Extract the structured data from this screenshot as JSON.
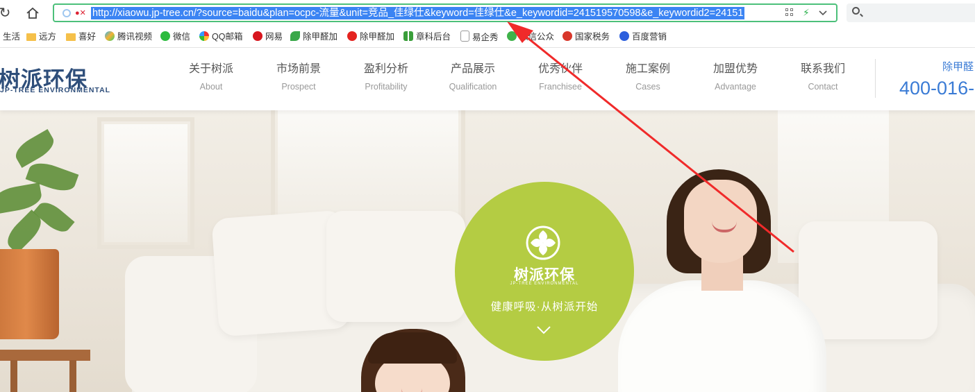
{
  "browser": {
    "url": "http://xiaowu.jp-tree.cn/?source=baidu&plan=ocpc-流量&unit=竞品_佳绿仕&keyword=佳绿仕&e_keywordid=241519570598&e_keywordid2=24151",
    "bookmarks": [
      {
        "label": "生活",
        "icon": "generic-icon"
      },
      {
        "label": "远方",
        "icon": "folder-icon"
      },
      {
        "label": "喜好",
        "icon": "folder-icon"
      },
      {
        "label": "腾讯视频",
        "icon": "tencent-video-icon"
      },
      {
        "label": "微信",
        "icon": "wechat-icon"
      },
      {
        "label": "QQ邮箱",
        "icon": "qq-mail-icon"
      },
      {
        "label": "网易",
        "icon": "netease-icon"
      },
      {
        "label": "除甲醛加",
        "icon": "leaf-icon"
      },
      {
        "label": "除甲醛加",
        "icon": "c-logo-icon"
      },
      {
        "label": "章科后台",
        "icon": "grid-icon"
      },
      {
        "label": "易企秀",
        "icon": "page-icon"
      },
      {
        "label": "微信公众",
        "icon": "wechat-mp-icon"
      },
      {
        "label": "国家税务",
        "icon": "tax-emblem-icon"
      },
      {
        "label": "百度营销",
        "icon": "baidu-icon"
      }
    ]
  },
  "site": {
    "logo_cn": "树派环保",
    "logo_en": "JP-TREE ENVIRONMENTAL",
    "menu": [
      {
        "cn": "关于树派",
        "en": "About"
      },
      {
        "cn": "市场前景",
        "en": "Prospect"
      },
      {
        "cn": "盈利分析",
        "en": "Profitability"
      },
      {
        "cn": "产品展示",
        "en": "Qualification"
      },
      {
        "cn": "优秀伙伴",
        "en": "Franchisee"
      },
      {
        "cn": "施工案例",
        "en": "Cases"
      },
      {
        "cn": "加盟优势",
        "en": "Advantage"
      },
      {
        "cn": "联系我们",
        "en": "Contact"
      }
    ],
    "contact_label": "除甲醛",
    "contact_phone": "400-016-"
  },
  "hero": {
    "brand": "树派环保",
    "brand_en": "JP-TREE ENVIRONMENTAL",
    "slogan": "健康呼吸·从树派开始"
  },
  "colors": {
    "accent_blue": "#3a7bd5",
    "badge_green": "#b4cc43",
    "url_highlight": "#3b84f3",
    "annotation_red": "#f02a2a"
  }
}
